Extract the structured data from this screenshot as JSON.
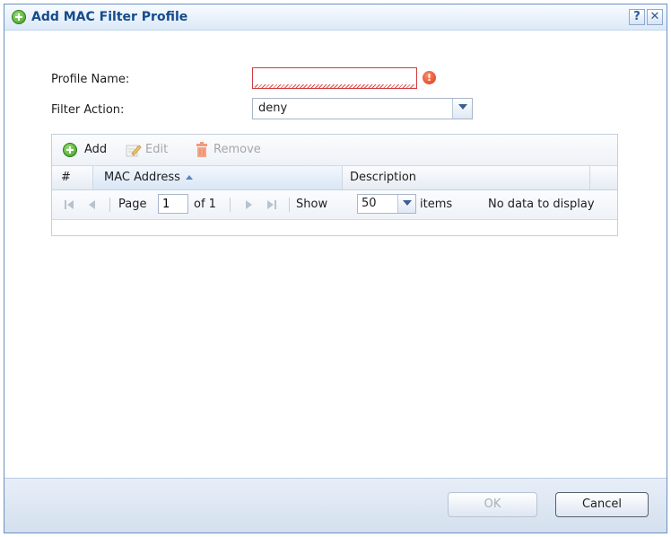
{
  "dialog": {
    "title": "Add MAC Filter Profile",
    "help_label": "?",
    "close_label": "✕"
  },
  "form": {
    "profile_name_label": "Profile Name:",
    "profile_name_value": "",
    "filter_action_label": "Filter Action:",
    "filter_action_value": "deny"
  },
  "toolbar": {
    "add_label": "Add",
    "edit_label": "Edit",
    "remove_label": "Remove"
  },
  "table": {
    "columns": [
      "#",
      "MAC Address",
      "Description"
    ],
    "rows": []
  },
  "pager": {
    "page_label": "Page",
    "page_value": "1",
    "of_label": "of 1",
    "show_label": "Show",
    "show_value": "50",
    "items_label": "items",
    "empty_text": "No data to display"
  },
  "footer": {
    "ok_label": "OK",
    "cancel_label": "Cancel"
  },
  "colors": {
    "title_text": "#154b8b",
    "error_border": "#d23b3b",
    "accent_green": "#3b9a1c"
  }
}
